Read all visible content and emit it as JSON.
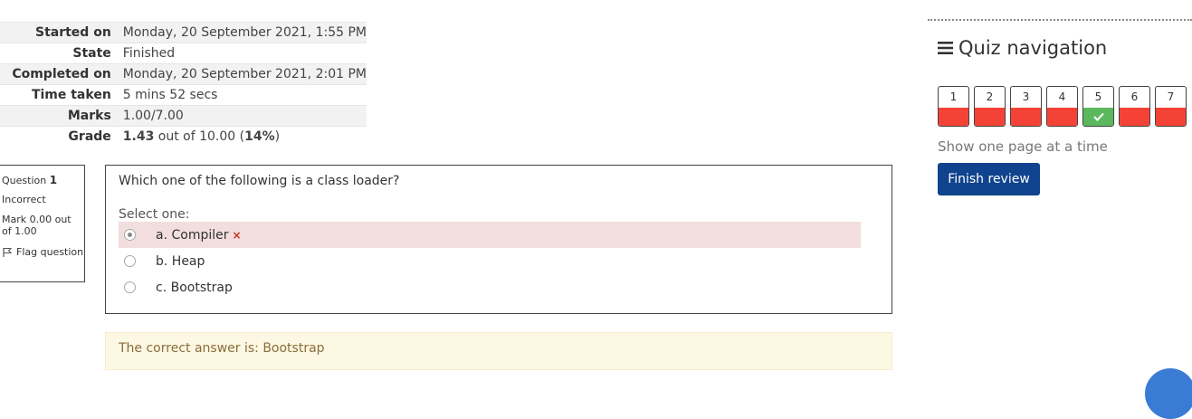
{
  "summary": {
    "rows": [
      {
        "label": "Started on",
        "value": "Monday, 20 September 2021, 1:55 PM"
      },
      {
        "label": "State",
        "value": "Finished"
      },
      {
        "label": "Completed on",
        "value": "Monday, 20 September 2021, 2:01 PM"
      },
      {
        "label": "Time taken",
        "value": "5 mins 52 secs"
      },
      {
        "label": "Marks",
        "value": "1.00/7.00"
      },
      {
        "label": "Grade",
        "value_bold": "1.43",
        "value_mid": " out of 10.00 (",
        "value_pct": "14%",
        "value_end": ")"
      }
    ]
  },
  "question": {
    "label": "Question ",
    "number": "1",
    "state": "Incorrect",
    "grade": "Mark 0.00 out of 1.00",
    "flag_label": "Flag question",
    "text": "Which one of the following is a class loader?",
    "prompt": "Select one:",
    "answers": [
      {
        "label": "a. Compiler",
        "checked": true,
        "incorrect": true
      },
      {
        "label": "b. Heap",
        "checked": false,
        "incorrect": false
      },
      {
        "label": "c. Bootstrap",
        "checked": false,
        "incorrect": false
      }
    ],
    "incorrect_mark": "×",
    "feedback": "The correct answer is: Bootstrap"
  },
  "nav": {
    "title": "Quiz navigation",
    "buttons": [
      {
        "number": "1",
        "status": "incorrect"
      },
      {
        "number": "2",
        "status": "incorrect"
      },
      {
        "number": "3",
        "status": "incorrect"
      },
      {
        "number": "4",
        "status": "incorrect"
      },
      {
        "number": "5",
        "status": "correct"
      },
      {
        "number": "6",
        "status": "incorrect"
      },
      {
        "number": "7",
        "status": "incorrect"
      }
    ],
    "show_one_page": "Show one page at a time",
    "finish_label": "Finish review"
  },
  "colors": {
    "incorrect": "#f44336",
    "correct": "#5cb85c",
    "primary": "#10438e"
  }
}
